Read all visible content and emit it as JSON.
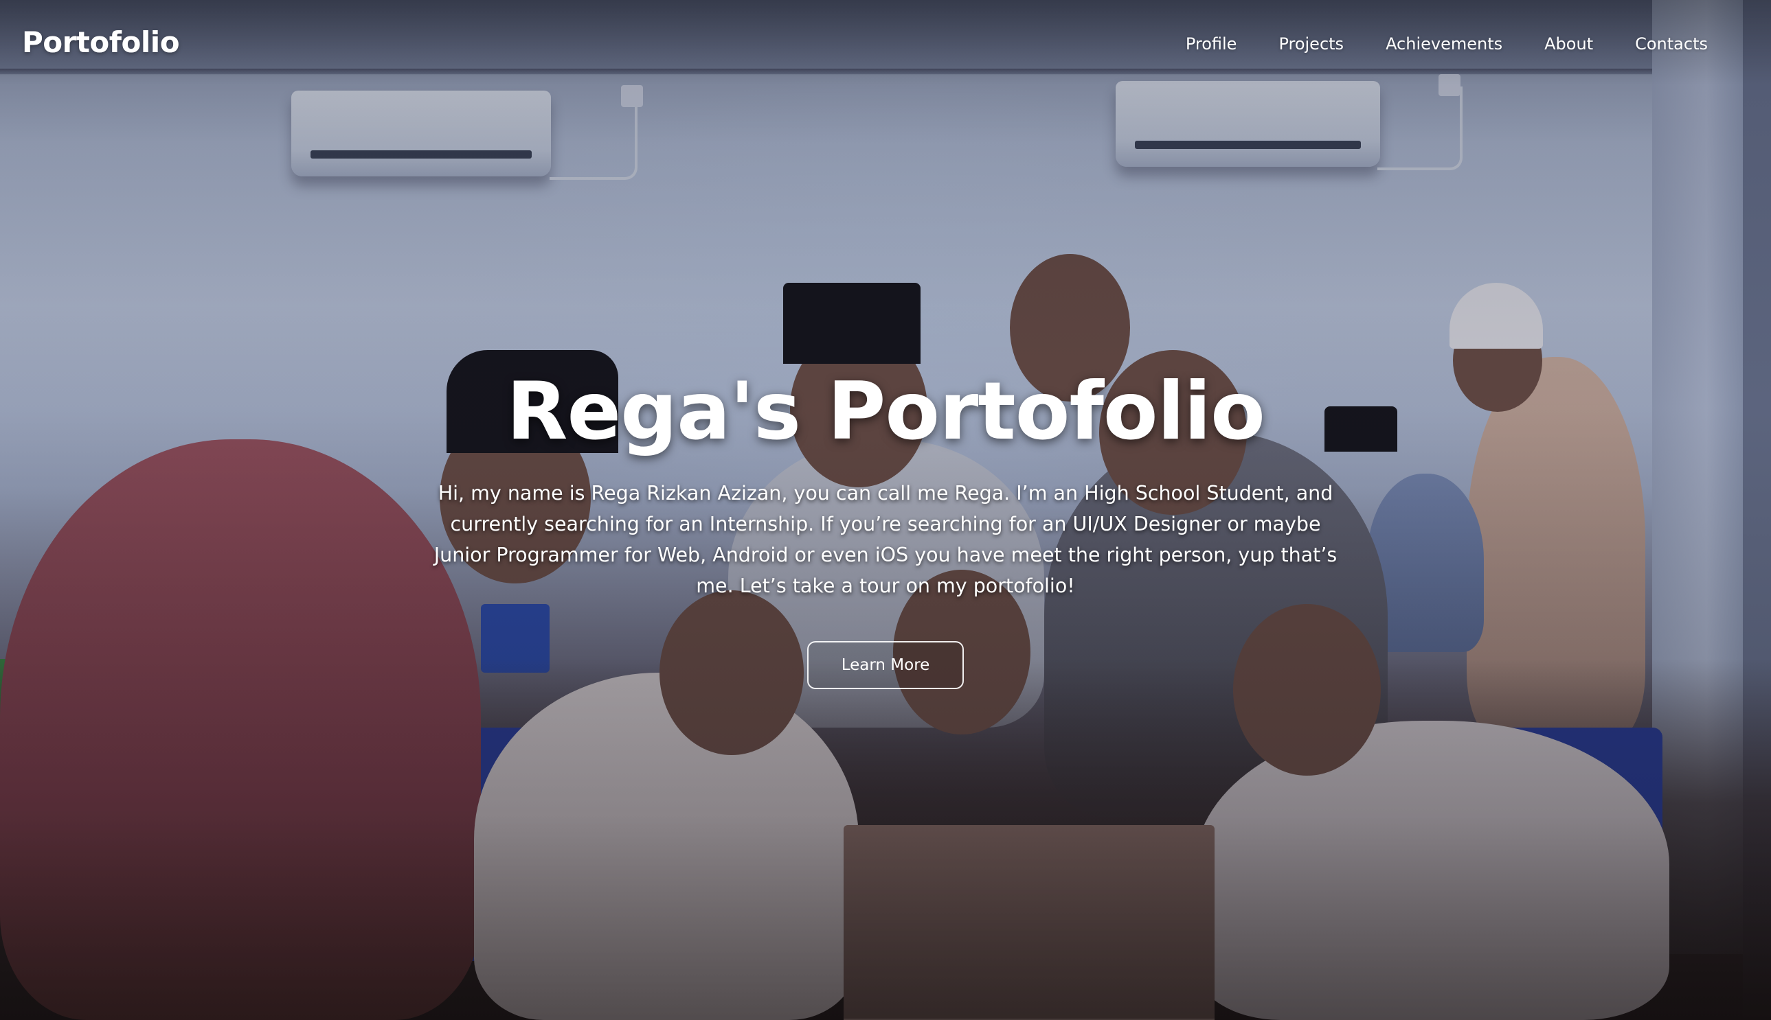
{
  "navbar": {
    "brand": "Portofolio",
    "links": [
      {
        "label": "Profile"
      },
      {
        "label": "Projects"
      },
      {
        "label": "Achievements"
      },
      {
        "label": "About"
      },
      {
        "label": "Contacts"
      }
    ]
  },
  "hero": {
    "title": "Rega's Portofolio",
    "description": "Hi, my name is Rega Rizkan Azizan, you can call me Rega. I’m an High School Student, and currently searching for an Internship. If you’re searching for an UI/UX Designer or maybe Junior Programmer for Web, Android or even iOS you have meet the right person, yup that’s me. Let’s take a tour on my portofolio!",
    "cta_label": "Learn More"
  },
  "colors": {
    "text": "#ffffff",
    "overlay": "#0a0c1e"
  }
}
